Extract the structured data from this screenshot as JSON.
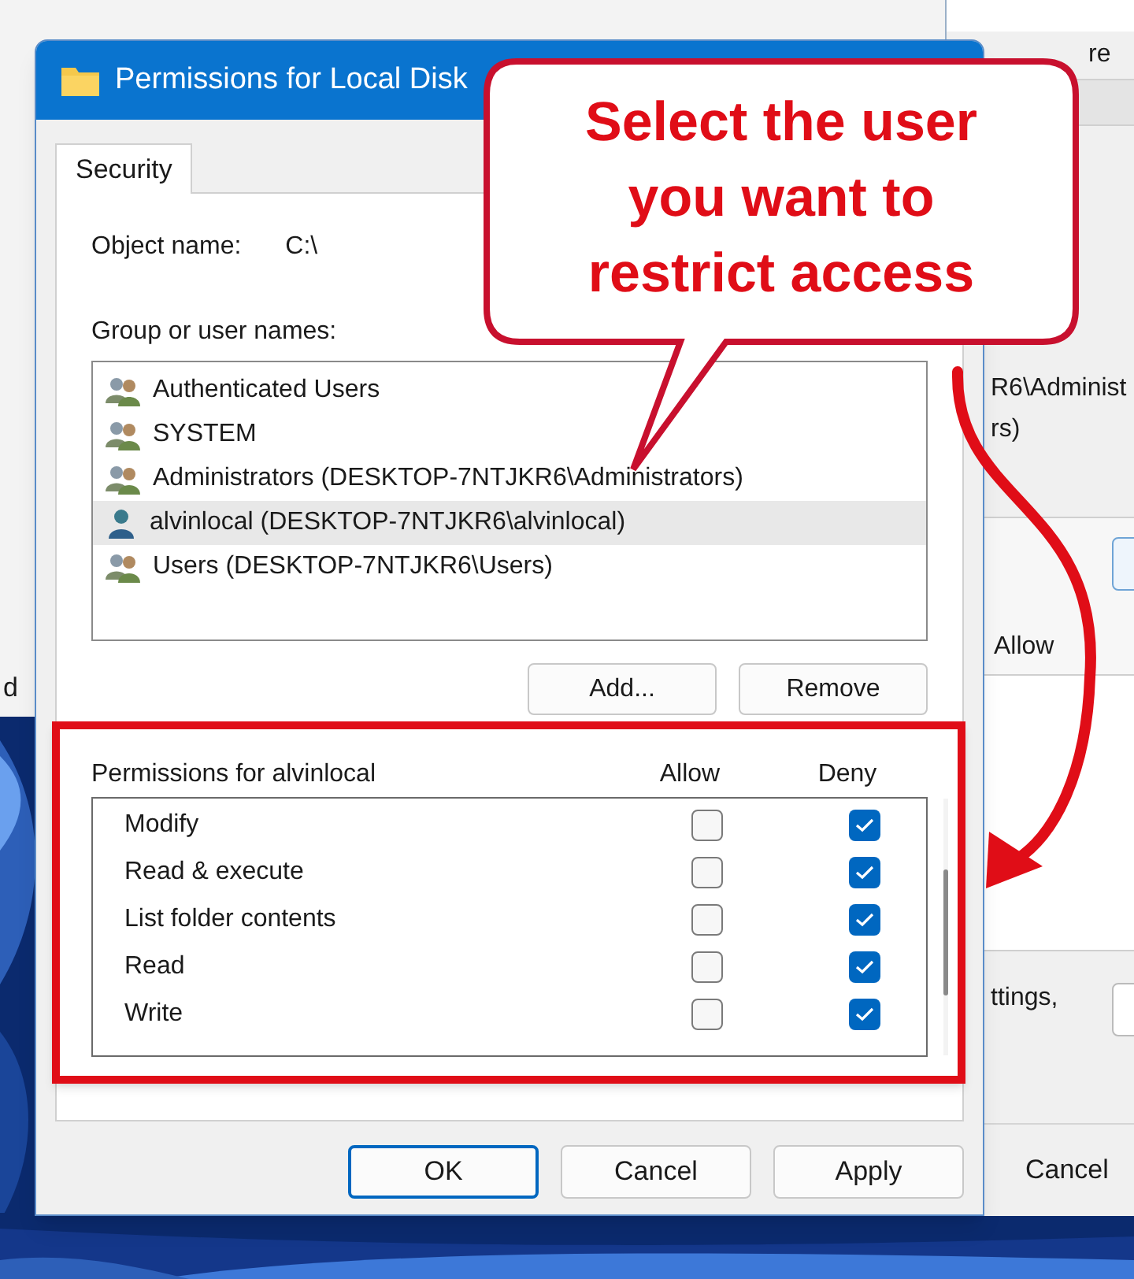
{
  "background_windows": {
    "left_text": "d",
    "right_tab": "re",
    "right_lines": [
      "R6\\Administ",
      "rs)"
    ],
    "right_column": "Allow",
    "right_note": "ttings,",
    "right_button": "Cancel"
  },
  "dialog": {
    "title": "Permissions for Local Disk",
    "tabs": [
      {
        "label": "Security",
        "selected": true
      }
    ],
    "object_label": "Object name:",
    "object_value": "C:\\",
    "group_label": "Group or user names:",
    "users": [
      {
        "name": "Authenticated Users",
        "kind": "group",
        "selected": false
      },
      {
        "name": "SYSTEM",
        "kind": "group",
        "selected": false
      },
      {
        "name": "Administrators (DESKTOP-7NTJKR6\\Administrators)",
        "kind": "group",
        "selected": false
      },
      {
        "name": "alvinlocal (DESKTOP-7NTJKR6\\alvinlocal)",
        "kind": "user",
        "selected": true
      },
      {
        "name": "Users (DESKTOP-7NTJKR6\\Users)",
        "kind": "group",
        "selected": false
      }
    ],
    "user_buttons": [
      "Add...",
      "Remove"
    ],
    "permissions": {
      "title": "Permissions for alvinlocal",
      "allow_header": "Allow",
      "deny_header": "Deny",
      "items": [
        {
          "name": "Modify",
          "allow": false,
          "deny": true
        },
        {
          "name": "Read & execute",
          "allow": false,
          "deny": true
        },
        {
          "name": "List folder contents",
          "allow": false,
          "deny": true
        },
        {
          "name": "Read",
          "allow": false,
          "deny": true
        },
        {
          "name": "Write",
          "allow": false,
          "deny": true
        }
      ]
    },
    "buttons": [
      "OK",
      "Cancel",
      "Apply"
    ]
  },
  "callout": {
    "text": "Select the user you want to restrict access"
  }
}
